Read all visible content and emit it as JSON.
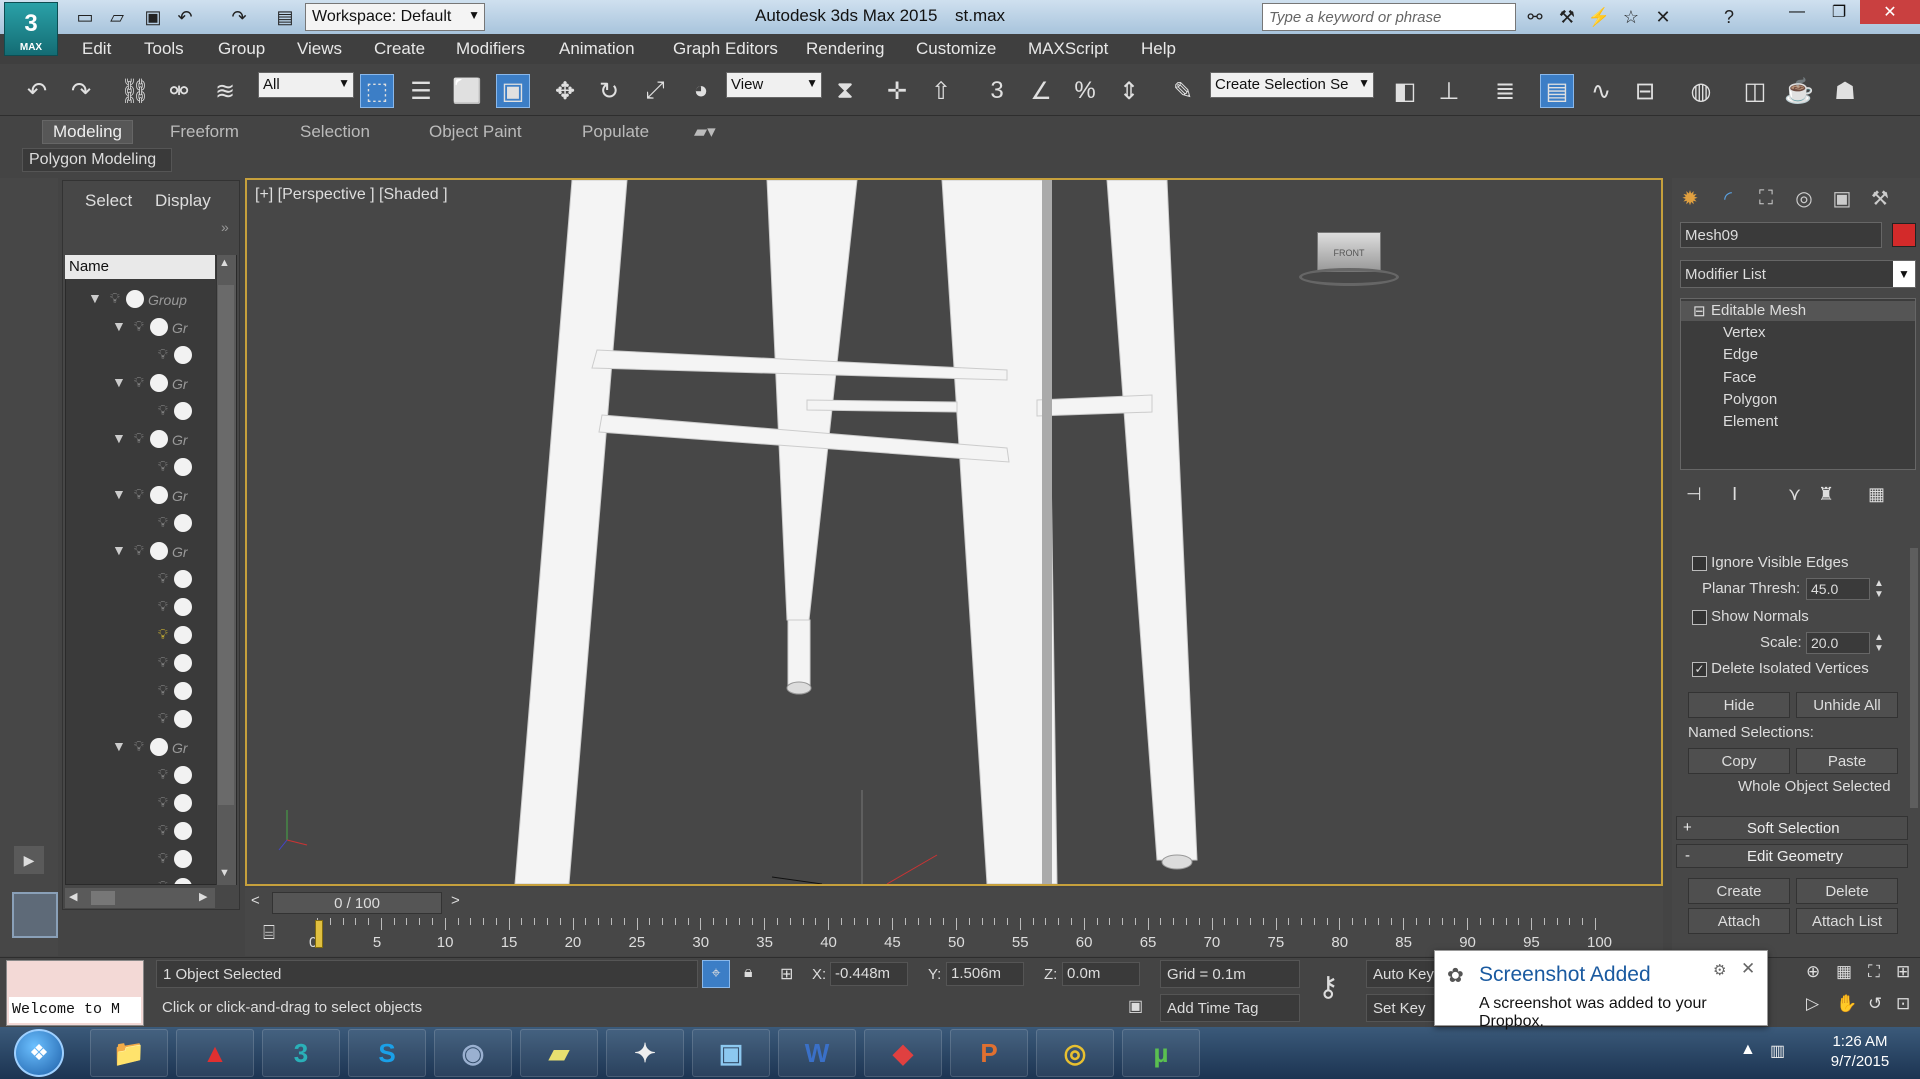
{
  "titlebar": {
    "workspace": "Workspace: Default",
    "app_title": "Autodesk 3ds Max  2015",
    "file_name": "st.max",
    "search_placeholder": "Type a keyword or phrase",
    "logo": "MAX"
  },
  "menu": [
    "Edit",
    "Tools",
    "Group",
    "Views",
    "Create",
    "Modifiers",
    "Animation",
    "Graph Editors",
    "Rendering",
    "Customize",
    "MAXScript",
    "Help"
  ],
  "toolbar": {
    "selection_filter": "All",
    "ref_coord": "View",
    "snap_3": "3",
    "snap_percent": "%",
    "named_selection": "Create Selection Se"
  },
  "ribbon": {
    "tabs": [
      "Modeling",
      "Freeform",
      "Selection",
      "Object Paint",
      "Populate"
    ],
    "active_tab": "Modeling",
    "panel_label": "Polygon Modeling"
  },
  "explorer": {
    "tabs": [
      "Select",
      "Display"
    ],
    "column_header": "Name",
    "rows": [
      {
        "label": "Group",
        "expand": true
      },
      {
        "label": "Gr",
        "expand": true
      },
      {
        "label": "",
        "expand": false
      },
      {
        "label": "Gr",
        "expand": true
      },
      {
        "label": "",
        "expand": false
      },
      {
        "label": "Gr",
        "expand": true
      },
      {
        "label": "",
        "expand": false
      },
      {
        "label": "Gr",
        "expand": true
      },
      {
        "label": "",
        "expand": false
      },
      {
        "label": "Gr",
        "expand": true
      },
      {
        "label": "",
        "expand": false
      },
      {
        "label": "",
        "expand": false
      },
      {
        "label": "",
        "expand": false,
        "lit": true
      },
      {
        "label": "",
        "expand": false
      },
      {
        "label": "",
        "expand": false
      },
      {
        "label": "",
        "expand": false
      },
      {
        "label": "Gr",
        "expand": true
      },
      {
        "label": "",
        "expand": false
      },
      {
        "label": "",
        "expand": false
      },
      {
        "label": "",
        "expand": false
      },
      {
        "label": "",
        "expand": false
      },
      {
        "label": "",
        "expand": false
      }
    ]
  },
  "viewport": {
    "label": "[+] [Perspective ] [Shaded ]",
    "viewcube_label": "FRONT"
  },
  "command_panel": {
    "object_name": "Mesh09",
    "object_color": "#d32a2a",
    "modifier_list": "Modifier List",
    "stack": {
      "root": "Editable Mesh",
      "subobjects": [
        "Vertex",
        "Edge",
        "Face",
        "Polygon",
        "Element"
      ]
    },
    "ignore_visible_edges": "Ignore Visible Edges",
    "planar_thresh_label": "Planar Thresh:",
    "planar_thresh_value": "45.0",
    "show_normals": "Show Normals",
    "scale_label": "Scale:",
    "scale_value": "20.0",
    "delete_isolated": "Delete Isolated Vertices",
    "hide": "Hide",
    "unhide_all": "Unhide All",
    "named_selections": "Named Selections:",
    "copy": "Copy",
    "paste": "Paste",
    "whole_object": "Whole Object Selected",
    "soft_selection": "Soft Selection",
    "soft_sign": "+",
    "edit_geometry": "Edit Geometry",
    "edit_sign": "-",
    "create": "Create",
    "delete": "Delete",
    "attach": "Attach",
    "attach_list": "Attach List"
  },
  "timeline": {
    "slider": "0 / 100",
    "prev": "<",
    "next": ">",
    "frame_start": 0,
    "frame_end": 100,
    "labels": [
      "0",
      "5",
      "10",
      "15",
      "20",
      "25",
      "30",
      "35",
      "40",
      "45",
      "50",
      "55",
      "60",
      "65",
      "70",
      "75",
      "80",
      "85",
      "90",
      "95",
      "100"
    ]
  },
  "status": {
    "maxscript_output": "Welcome to M",
    "selection": "1 Object Selected",
    "prompt": "Click or click-and-drag to select objects",
    "x_label": "X:",
    "x_value": "-0.448m",
    "y_label": "Y:",
    "y_value": "1.506m",
    "z_label": "Z:",
    "z_value": "0.0m",
    "grid": "Grid = 0.1m",
    "add_time_tag": "Add Time Tag",
    "auto_key": "Auto Key",
    "set_key": "Set Key"
  },
  "toast": {
    "title": "Screenshot Added",
    "message": "A screenshot was added to your Dropbox."
  },
  "taskbar": {
    "time": "1:26 AM",
    "date": "9/7/2015",
    "apps": [
      {
        "name": "explorer",
        "glyph": "📁",
        "color": "#f0c040"
      },
      {
        "name": "acrobat",
        "glyph": "▲",
        "color": "#e03030"
      },
      {
        "name": "3dsmax",
        "glyph": "3",
        "color": "#2ab0b8"
      },
      {
        "name": "skype",
        "glyph": "S",
        "color": "#1aa0e8"
      },
      {
        "name": "cinema4d",
        "glyph": "◉",
        "color": "#9ab0d0"
      },
      {
        "name": "sticky-notes",
        "glyph": "▰",
        "color": "#e8e070"
      },
      {
        "name": "poser",
        "glyph": "✦",
        "color": "#eeeeee"
      },
      {
        "name": "photos",
        "glyph": "▣",
        "color": "#8cc8f0"
      },
      {
        "name": "word",
        "glyph": "W",
        "color": "#3a70c8"
      },
      {
        "name": "sketchup",
        "glyph": "◆",
        "color": "#e04040"
      },
      {
        "name": "powerpoint",
        "glyph": "P",
        "color": "#e07030"
      },
      {
        "name": "chrome",
        "glyph": "◎",
        "color": "#e8c030"
      },
      {
        "name": "utorrent",
        "glyph": "µ",
        "color": "#5ac050"
      }
    ]
  }
}
